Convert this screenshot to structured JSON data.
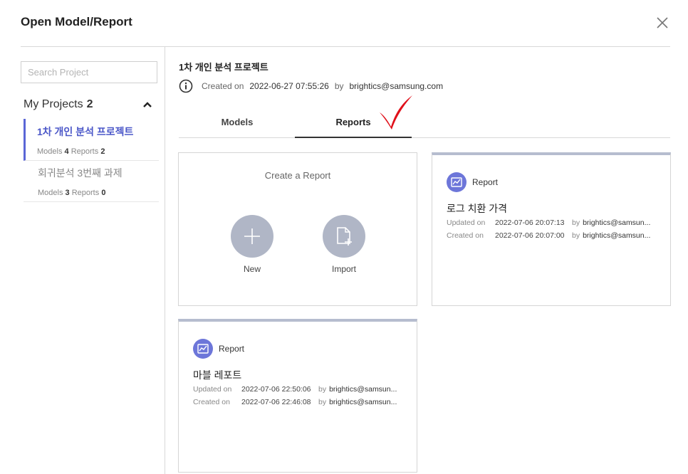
{
  "dialog": {
    "title": "Open Model/Report",
    "close_icon": "close-icon"
  },
  "sidebar": {
    "search_placeholder": "Search Project",
    "my_projects_label": "My Projects",
    "my_projects_count": "2",
    "projects": [
      {
        "name": "1차 개인 분석 프로젝트",
        "models_label": "Models",
        "models_count": "4",
        "reports_label": "Reports",
        "reports_count": "2",
        "active": true
      },
      {
        "name": "회귀분석 3번째 과제",
        "models_label": "Models",
        "models_count": "3",
        "reports_label": "Reports",
        "reports_count": "0",
        "active": false
      }
    ]
  },
  "project": {
    "title": "1차 개인 분석 프로젝트",
    "created_label": "Created on",
    "created_date": "2022-06-27 07:55:26",
    "by_label": "by",
    "created_by": "brightics@samsung.com"
  },
  "tabs": [
    {
      "label": "Models",
      "active": false
    },
    {
      "label": "Reports",
      "active": true
    }
  ],
  "create_card": {
    "title": "Create a Report",
    "new_label": "New",
    "import_label": "Import"
  },
  "reports": [
    {
      "type_label": "Report",
      "name": "로그 치환 가격",
      "updated_label": "Updated on",
      "updated_date": "2022-07-06 20:07:13",
      "updated_by": "brightics@samsun...",
      "created_label": "Created on",
      "created_date": "2022-07-06 20:07:00",
      "created_by": "brightics@samsun...",
      "by_label": "by"
    },
    {
      "type_label": "Report",
      "name": "마블 레포트",
      "updated_label": "Updated on",
      "updated_date": "2022-07-06 22:50:06",
      "updated_by": "brightics@samsun...",
      "created_label": "Created on",
      "created_date": "2022-07-06 22:46:08",
      "created_by": "brightics@samsun...",
      "by_label": "by"
    }
  ],
  "colors": {
    "accent": "#5a66d6",
    "checkmark": "#e0101a",
    "circle_button": "#b0b6c6",
    "report_icon": "#6d76d9"
  }
}
